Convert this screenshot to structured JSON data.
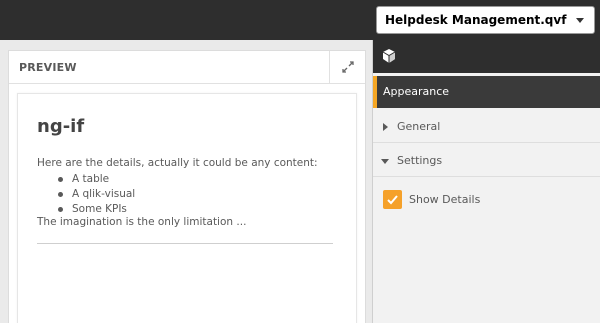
{
  "topbar": {
    "app_name": "Helpdesk Management.qvf"
  },
  "preview": {
    "title": "PREVIEW",
    "content": {
      "heading": "ng-if",
      "intro": "Here are the details, actually it could be any content:",
      "bullets": [
        "A table",
        "A qlik-visual",
        "Some KPIs"
      ],
      "closing": "The imagination is the only limitation ..."
    }
  },
  "properties": {
    "top_icon": "extension-icon",
    "sections": [
      {
        "label": "Appearance",
        "state": "active"
      },
      {
        "label": "General",
        "state": "collapsed"
      },
      {
        "label": "Settings",
        "state": "expanded"
      }
    ],
    "settings": {
      "show_details": {
        "label": "Show Details",
        "checked": true
      }
    }
  },
  "colors": {
    "accent": "#f5a623",
    "topbar": "#2e2e2e"
  }
}
